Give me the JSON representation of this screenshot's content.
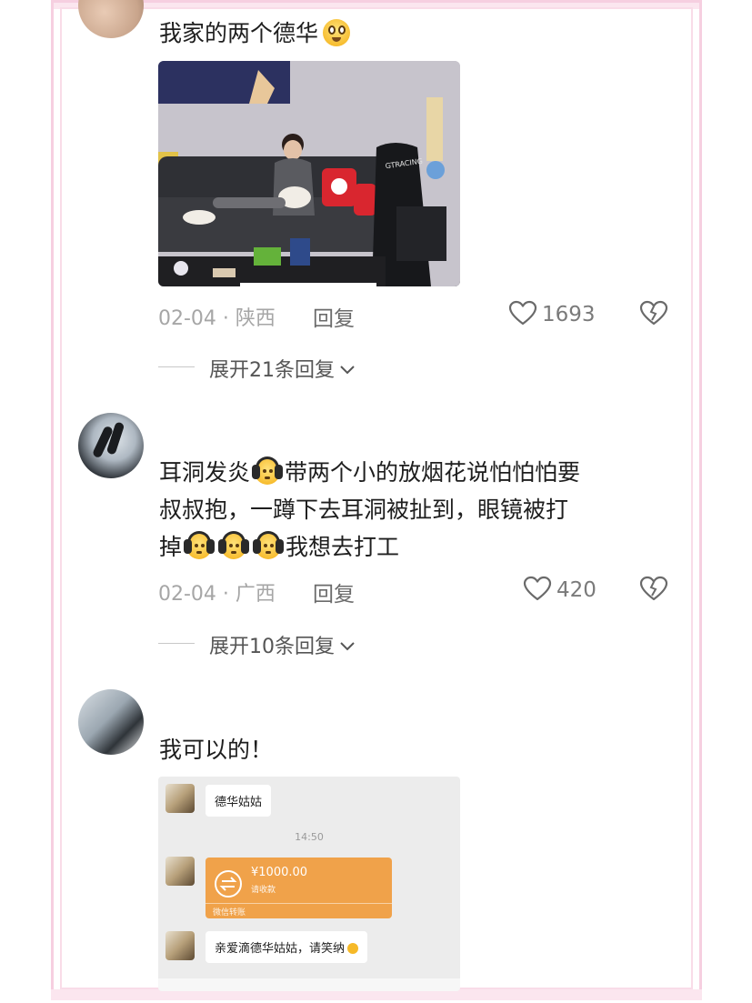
{
  "comments": [
    {
      "text": "我家的两个德华",
      "location_time": "02-04 · 陕西",
      "reply_label": "回复",
      "likes": "1693",
      "expand": "展开21条回复"
    },
    {
      "text_parts": [
        "耳洞发炎",
        "带两个小的放烟花说怕怕怕要",
        "叔叔抱，一蹲下去耳洞被扯到，眼镜被打",
        "掉",
        "我想去打工"
      ],
      "location_time": "02-04 · 广西",
      "reply_label": "回复",
      "likes": "420",
      "expand": "展开10条回复"
    },
    {
      "text": "我可以的！"
    }
  ],
  "chat": {
    "contact_label": "德华姑姑",
    "time": "14:50",
    "amount": "¥1000.00",
    "transfer_note": "请收款",
    "transfer_footer": "微信转账",
    "message": "亲爱滴德华姑姑，请笑纳"
  },
  "photo": {
    "brand_text": "GTRACING"
  },
  "colors": {
    "frame_pink": "#f6cfe0",
    "transfer_orange": "#f0a24a"
  },
  "icons": [
    "heart-icon",
    "broken-heart-icon",
    "chevron-down-icon",
    "headphone-face-emoji",
    "teary-face-emoji"
  ]
}
